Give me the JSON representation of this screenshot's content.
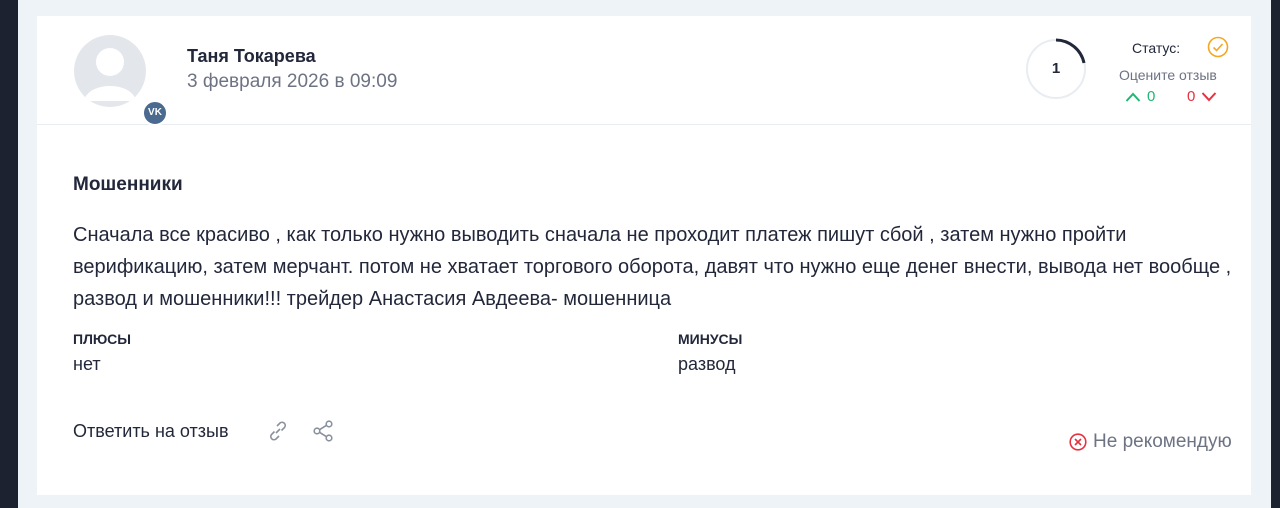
{
  "review": {
    "author": "Таня Токарева",
    "date": "3 февраля 2026 в 09:09",
    "avatar_badge": "vk-icon",
    "rating": "1",
    "status_label": "Статус:",
    "rate_label": "Оцените отзыв",
    "votes_up": "0",
    "votes_down": "0",
    "title": "Мошенники",
    "text": "Сначала все красиво , как только нужно выводить сначала не проходит платеж пишут сбой , затем нужно пройти верификацию, затем мерчант. потом не хватает торгового оборота, давят что нужно еще денег внести, вывода нет вообще , развод и мошенники!!! трейдер Анастасия Авдеева- мошенница",
    "pros_label": "ПЛЮСЫ",
    "pros_value": "нет",
    "cons_label": "МИНУСЫ",
    "cons_value": "развод",
    "reply_label": "Ответить на отзыв",
    "not_recommend_label": "Не рекомендую"
  },
  "colors": {
    "accent_orange": "#f5a623",
    "up_green": "#22b573",
    "down_red": "#e5323e",
    "text_dark": "#22273a",
    "text_muted": "#6d7383"
  }
}
